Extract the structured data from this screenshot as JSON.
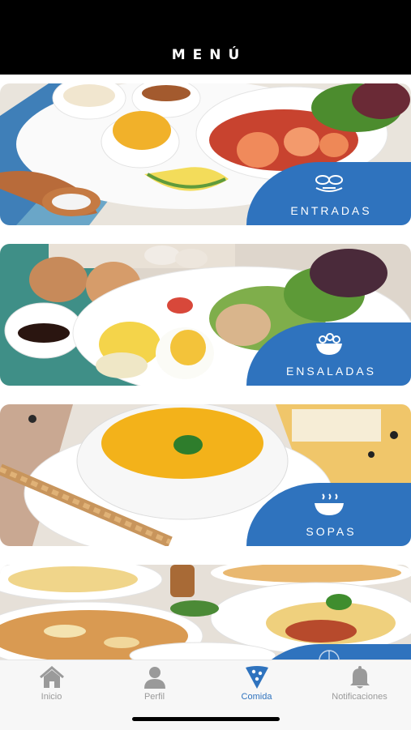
{
  "header": {
    "title": "MENÚ"
  },
  "categories": [
    {
      "label": "ENTRADAS",
      "icon": "entradas-icon"
    },
    {
      "label": "ENSALADAS",
      "icon": "ensaladas-icon"
    },
    {
      "label": "SOPAS",
      "icon": "sopas-icon"
    },
    {
      "label": "",
      "icon": "pizza-icon"
    }
  ],
  "bottom_nav": {
    "items": [
      {
        "label": "Inicio",
        "icon": "home-icon"
      },
      {
        "label": "Perfil",
        "icon": "user-icon"
      },
      {
        "label": "Comida",
        "icon": "pizza-slice-icon"
      },
      {
        "label": "Notificaciones",
        "icon": "bell-icon"
      }
    ],
    "active": "Comida"
  },
  "colors": {
    "accent": "#2f73be",
    "header": "#000000",
    "inactive": "#9a9a9a"
  }
}
